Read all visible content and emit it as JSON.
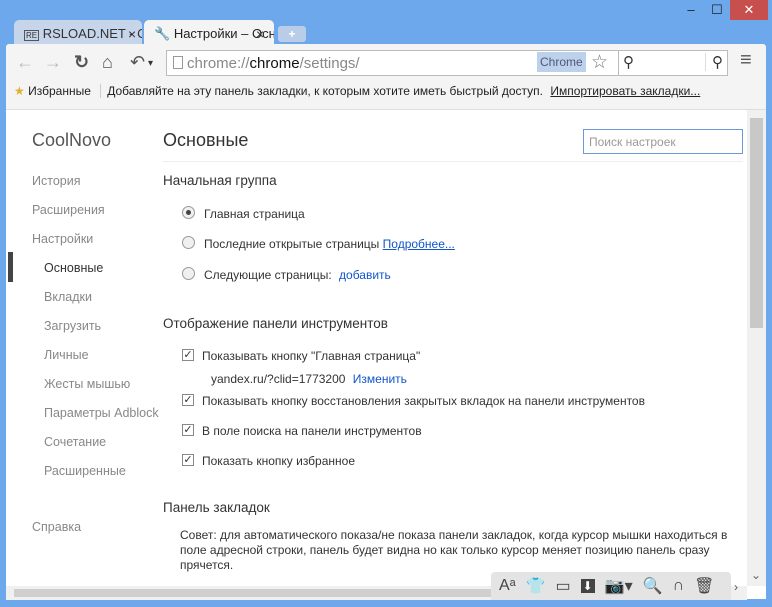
{
  "window": {
    "minimize": "‒",
    "maximize": "☐",
    "close": "✕"
  },
  "tabs": [
    {
      "label": "RSLOAD.NET - Скачать сс",
      "close": "×"
    },
    {
      "label": "Настройки – Основные",
      "close": "×"
    }
  ],
  "new_tab": "+",
  "toolbar": {
    "back": "←",
    "forward": "→",
    "reload": "↻",
    "home": "⌂",
    "undo": "↶",
    "undo_menu": "▾",
    "url_prefix": "chrome://",
    "url_host": "chrome",
    "url_path": "/settings/",
    "url_badge": "Chrome",
    "star": "☆",
    "search_icon": "⚲",
    "menu": "≡"
  },
  "bookmarks": {
    "favorites": "Избранные",
    "hint": "Добавляйте на эту панель закладки, к которым хотите иметь быстрый доступ.",
    "import": "Импортировать закладки..."
  },
  "sidebar": {
    "brand": "CoolNovo",
    "items": [
      "История",
      "Расширения",
      "Настройки"
    ],
    "sub": [
      "Основные",
      "Вкладки",
      "Загрузить",
      "Личные",
      "Жесты мышью",
      "Параметры Adblock",
      "Сочетание",
      "Расширенные"
    ],
    "help": "Справка"
  },
  "main": {
    "title": "Основные",
    "search_placeholder": "Поиск настроек",
    "startup": {
      "heading": "Начальная группа",
      "options": [
        "Главная страница",
        "Последние открытые страницы",
        "Следующие страницы:"
      ],
      "more": "Подробнее...",
      "add": "добавить"
    },
    "toolbar_section": {
      "heading": "Отображение панели инструментов",
      "options": [
        "Показывать кнопку \"Главная страница\"",
        "Показывать кнопку восстановления закрытых вкладок на панели инструментов",
        "В поле поиска на панели инструментов",
        "Показать кнопку избранное"
      ],
      "home_url": "yandex.ru/?clid=1773200",
      "change": "Изменить"
    },
    "bookmarks_section": {
      "heading": "Панель закладок",
      "tip": "Совет: для автоматического показа/не показа панели закладок, когда курсор мышки находиться в поле адресной строки, панель будет видна но как только курсор меняет позицию панель сразу прячется."
    }
  },
  "bottom_toolbar": {
    "font": "Aᵃ",
    "arrow_right": "›",
    "scroll_down": "⌄"
  }
}
